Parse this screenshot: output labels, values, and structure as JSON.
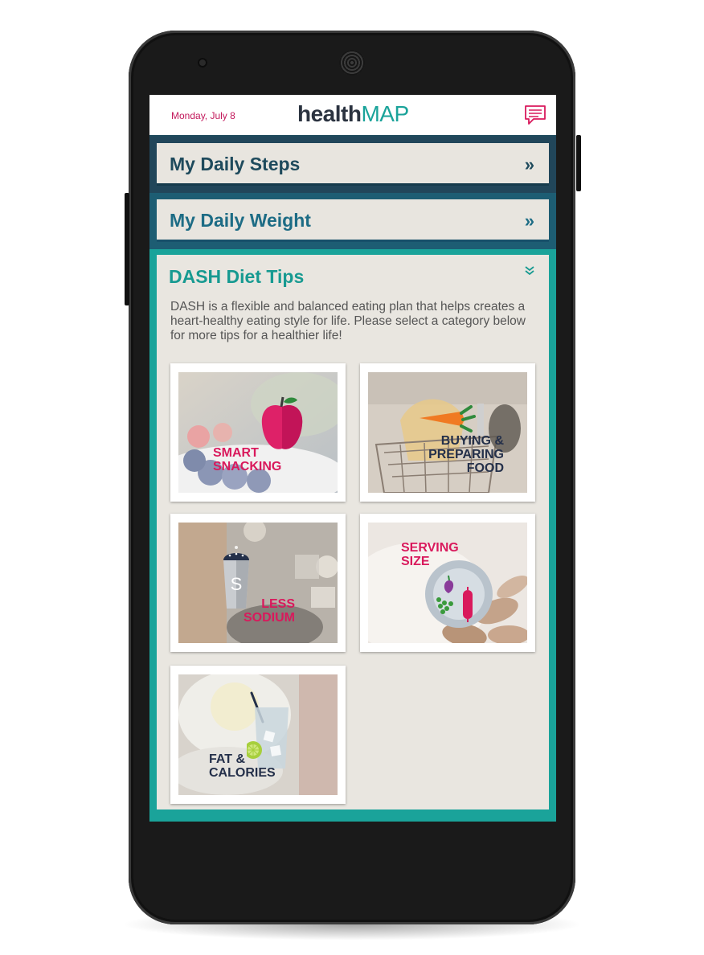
{
  "header": {
    "date": "Monday, July 8",
    "logo_part1": "health",
    "logo_part2": "MAP",
    "message_icon": "chat-bubble-icon"
  },
  "panels": {
    "steps": {
      "title": "My Daily Steps",
      "chevron": "»"
    },
    "weight": {
      "title": "My Daily Weight",
      "chevron": "»"
    },
    "dash": {
      "title": "DASH Diet Tips",
      "chevron": "»",
      "description": "DASH is a flexible and balanced eating plan that helps creates a heart-healthy eating style for life. Please select a category below for more tips for a healthier life!"
    }
  },
  "tiles": {
    "smart": {
      "line1": "SMART",
      "line2": "SNACKING",
      "icon": "apple-icon"
    },
    "buying": {
      "line1": "BUYING &",
      "line2": "PREPARING",
      "line3": "FOOD",
      "icon": "carrot-knife-icon"
    },
    "sodium": {
      "line1": "LESS",
      "line2": "SODIUM",
      "icon": "salt-shaker-icon"
    },
    "serving": {
      "line1": "SERVING",
      "line2": "SIZE",
      "icon": "plate-icon"
    },
    "fat": {
      "line1": "FAT &",
      "line2": "CALORIES",
      "icon": "drink-glass-icon"
    }
  },
  "colors": {
    "pink": "#d9195c",
    "teal": "#1aa39a",
    "navy": "#1e4a5c"
  }
}
